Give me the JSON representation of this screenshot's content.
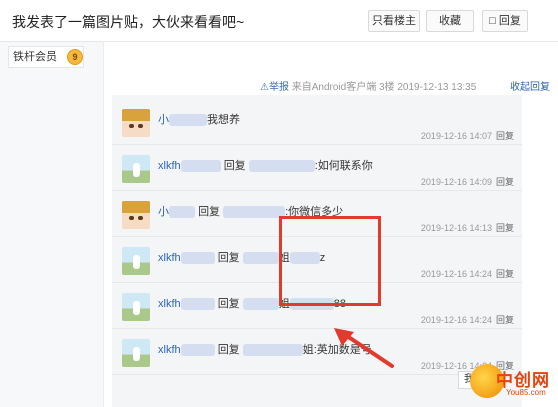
{
  "header": {
    "title": "我发表了一篇图片贴，大伙来看看吧~",
    "btn_only_host": "只看楼主",
    "btn_favorite": "收藏",
    "btn_reply": "回复"
  },
  "user": {
    "member_label": "铁杆会员",
    "level": "9"
  },
  "floor_meta": {
    "report": "举报",
    "source": "来自Android客户端",
    "floor": "3楼",
    "time": "2019-12-13 13:35",
    "collapse_reply": "收起回复"
  },
  "replies": [
    {
      "name": "小",
      "text": "我想养",
      "time": "2019-12-16 14:07",
      "reply_label": "回复",
      "avatar": "anime"
    },
    {
      "name": "xlkfh",
      "connector": "回复",
      "text": ":如何联系你",
      "time": "2019-12-16 14:09",
      "reply_label": "回复",
      "avatar": "scene"
    },
    {
      "name": "小",
      "connector": "回复",
      "text": ":你微信多少",
      "time": "2019-12-16 14:13",
      "reply_label": "回复",
      "avatar": "anime"
    },
    {
      "name": "xlkfh",
      "connector": "回复",
      "mid": "姐",
      "text": "z",
      "time": "2019-12-16 14:24",
      "reply_label": "回复",
      "avatar": "scene"
    },
    {
      "name": "xlkfh",
      "connector": "回复",
      "mid": "姐",
      "text": "88",
      "time": "2019-12-16 14:24",
      "reply_label": "回复",
      "avatar": "scene"
    },
    {
      "name": "xlkfh",
      "connector": "回复",
      "mid": "姐",
      "text": ":英加数是号",
      "time": "2019-12-16 14:24",
      "reply_label": "回复",
      "avatar": "scene"
    }
  ],
  "footer": {
    "i_also_say": "我也说"
  },
  "watermark": {
    "brand": "中创网",
    "sub": "You85.com"
  },
  "colors": {
    "link": "#2d64b3",
    "highlight_box": "#e23b2e",
    "watermark": "#e8430b"
  }
}
